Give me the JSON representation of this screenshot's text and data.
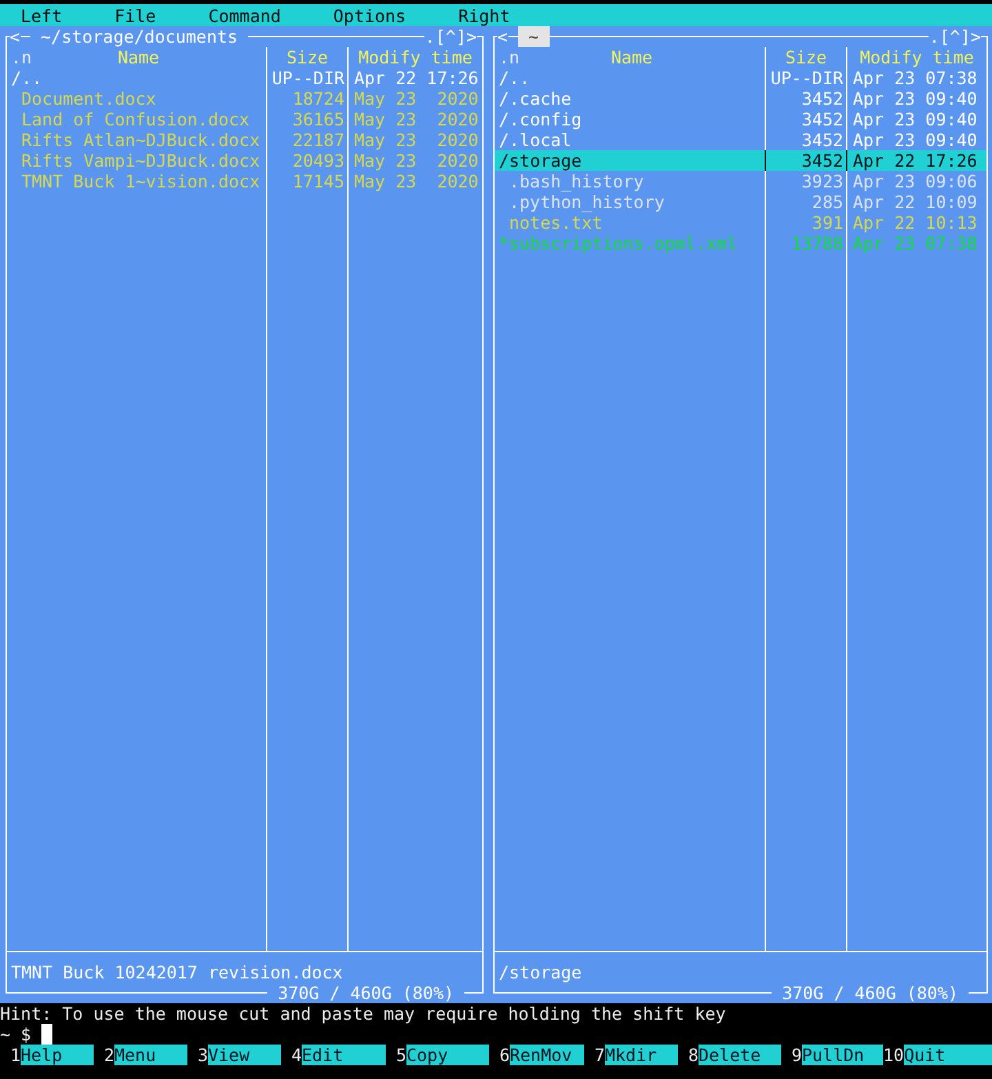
{
  "menu_bar": [
    {
      "label": "Left"
    },
    {
      "label": "File"
    },
    {
      "label": "Command"
    },
    {
      "label": "Options"
    },
    {
      "label": "Right"
    }
  ],
  "panels": [
    {
      "active": false,
      "history_back": "<",
      "path": "~/storage/documents",
      "controls": [
        ".",
        "[^]",
        ">"
      ],
      "sort_indicator": ".n",
      "columns": [
        "Name",
        "Size",
        "Modify time"
      ],
      "rows": [
        {
          "name": "/..",
          "size": "UP--DIR",
          "modified": "Apr 22 17:26",
          "kind": "directory",
          "selected": false
        },
        {
          "name": "Document.docx",
          "size": "18724",
          "modified": "May 23  2020",
          "kind": "document",
          "selected": false
        },
        {
          "name": "Land of Confusion.docx",
          "size": "36165",
          "modified": "May 23  2020",
          "kind": "document",
          "selected": false
        },
        {
          "name": "Rifts Atlan~DJBuck.docx",
          "size": "22187",
          "modified": "May 23  2020",
          "kind": "document",
          "selected": false
        },
        {
          "name": "Rifts Vampi~DJBuck.docx",
          "size": "20493",
          "modified": "May 23  2020",
          "kind": "document",
          "selected": false
        },
        {
          "name": "TMNT Buck 1~vision.docx",
          "size": "17145",
          "modified": "May 23  2020",
          "kind": "document",
          "selected": false
        }
      ],
      "mini_status": "TMNT Buck 10242017 revision.docx",
      "disk_usage": "370G / 460G (80%)"
    },
    {
      "active": true,
      "history_back": "<",
      "path": "~",
      "controls": [
        ".",
        "[^]",
        ">"
      ],
      "sort_indicator": ".n",
      "columns": [
        "Name",
        "Size",
        "Modify time"
      ],
      "rows": [
        {
          "name": "/..",
          "size": "UP--DIR",
          "modified": "Apr 23 07:38",
          "kind": "directory",
          "selected": false
        },
        {
          "name": "/.cache",
          "size": "3452",
          "modified": "Apr 23 09:40",
          "kind": "directory",
          "selected": false
        },
        {
          "name": "/.config",
          "size": "3452",
          "modified": "Apr 23 09:40",
          "kind": "directory",
          "selected": false
        },
        {
          "name": "/.local",
          "size": "3452",
          "modified": "Apr 23 09:40",
          "kind": "directory",
          "selected": false
        },
        {
          "name": "/storage",
          "size": "3452",
          "modified": "Apr 22 17:26",
          "kind": "directory",
          "selected": true
        },
        {
          "name": ".bash_history",
          "size": "3923",
          "modified": "Apr 23 09:06",
          "kind": "hidden",
          "selected": false
        },
        {
          "name": ".python_history",
          "size": "285",
          "modified": "Apr 22 10:09",
          "kind": "hidden",
          "selected": false
        },
        {
          "name": "notes.txt",
          "size": "391",
          "modified": "Apr 22 10:13",
          "kind": "document",
          "selected": false
        },
        {
          "name": "*subscriptions.opml.xml",
          "size": "13788",
          "modified": "Apr 23 07:38",
          "kind": "executable",
          "selected": false
        }
      ],
      "mini_status": "/storage",
      "disk_usage": "370G / 460G (80%)"
    }
  ],
  "hint": "Hint: To use the mouse cut and paste may require holding the shift key",
  "prompt": "~ $",
  "function_keys": [
    {
      "number": "1",
      "label": "Help"
    },
    {
      "number": "2",
      "label": "Menu"
    },
    {
      "number": "3",
      "label": "View"
    },
    {
      "number": "4",
      "label": "Edit"
    },
    {
      "number": "5",
      "label": "Copy"
    },
    {
      "number": "6",
      "label": "RenMov"
    },
    {
      "number": "7",
      "label": "Mkdir"
    },
    {
      "number": "8",
      "label": "Delete"
    },
    {
      "number": "9",
      "label": "PullDn"
    },
    {
      "number": "10",
      "label": "Quit"
    }
  ]
}
